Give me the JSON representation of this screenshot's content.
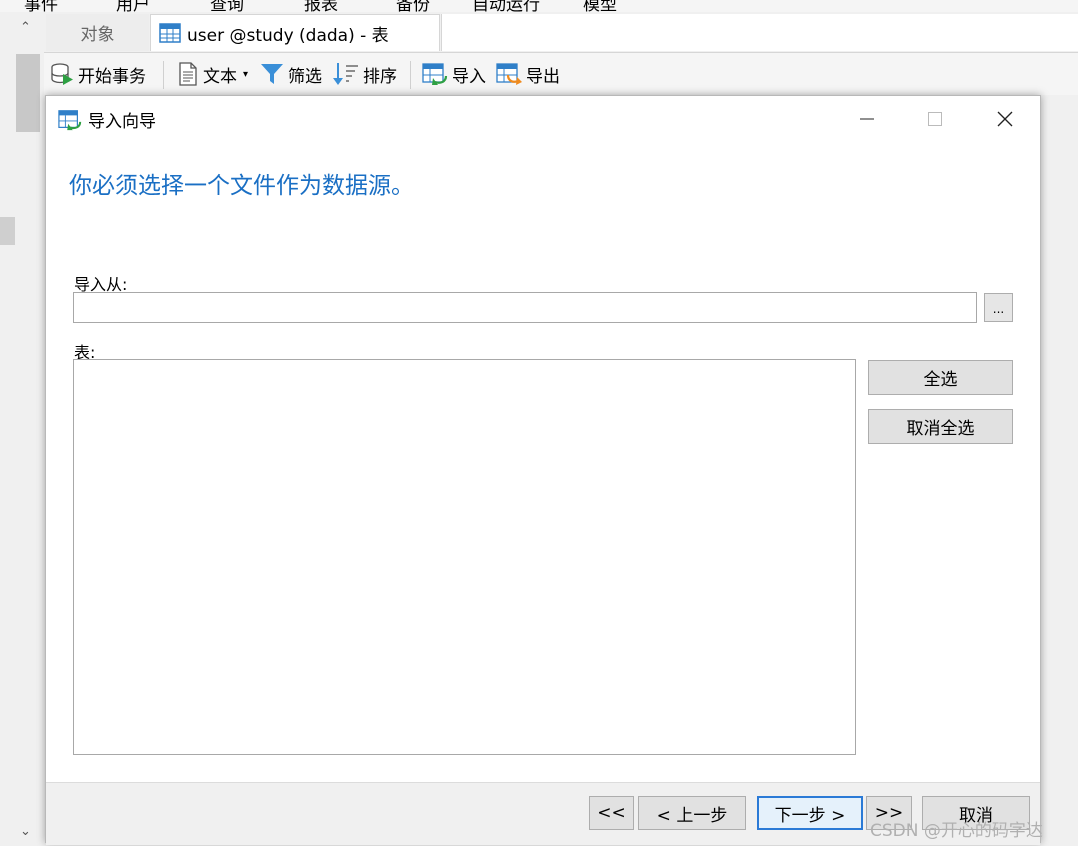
{
  "menubar": {
    "items": [
      "事件",
      "用户",
      "查询",
      "报表",
      "备份",
      "自动运行",
      "模型"
    ]
  },
  "tabs": {
    "objects_label": "对象",
    "table_tab_label": "user @study (dada) - 表"
  },
  "toolbar": {
    "begin_transaction": "开始事务",
    "text": "文本",
    "filter": "筛选",
    "sort": "排序",
    "import": "导入",
    "export": "导出"
  },
  "dialog": {
    "title": "导入向导",
    "heading": "你必须选择一个文件作为数据源。",
    "import_from_label": "导入从:",
    "import_from_value": "",
    "browse_label": "...",
    "table_label": "表:",
    "select_all": "全选",
    "deselect_all": "取消全选",
    "buttons": {
      "first": "<<",
      "prev": "< 上一步",
      "next": "下一步 >",
      "last": ">>",
      "cancel": "取消"
    }
  },
  "watermark": "CSDN @开心的码字达",
  "colors": {
    "accent": "#1a6fc4",
    "focus_border": "#2b7ad6"
  }
}
